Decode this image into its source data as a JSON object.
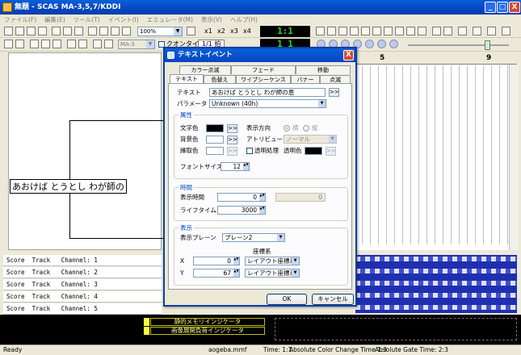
{
  "window": {
    "title": "無題 - SCAS MA-3,5,7/KDDI",
    "minimize": "_",
    "maximize": "□",
    "close": "X"
  },
  "menu": [
    "ファイル(F)",
    "編集(E)",
    "ツール(T)",
    "イベント(I)",
    "エミュレータ(M)",
    "表示(V)",
    "ヘルプ(H)"
  ],
  "toolbar": {
    "zoom": "100%",
    "scale_x1": "x1",
    "scale_x2": "x2",
    "scale_x3": "x3",
    "scale_x4": "x4",
    "lcd": "1:1",
    "model": "MA-3",
    "qwantize_label": "クオンタイズ",
    "beat": "1/1 拍"
  },
  "timeline": {
    "marker_5": "5",
    "marker_9": "9"
  },
  "editor": {
    "text": "あおけば とうとし わが師の"
  },
  "tracks": [
    {
      "label": "Score  Track   Channel: 1"
    },
    {
      "label": "Score  Track   Channel: 2"
    },
    {
      "label": "Score  Track   Channel: 3"
    },
    {
      "label": "Score  Track   Channel: 4"
    },
    {
      "label": "Score  Track   Channel: 5"
    }
  ],
  "indicators": {
    "memory": "静的メモリインジケータ",
    "image": "画像展開負荷インジケータ"
  },
  "status": {
    "ready": "Ready",
    "file": "aogeba.mmf",
    "time": "Time: 1:1",
    "color_change": "Absolute Color Change Time 1:3",
    "gate": "Absolute Gate Time: 2:3"
  },
  "dialog": {
    "title": "テキストイベント",
    "close": "X",
    "tabs_back": [
      "カラー点滅",
      "フェード",
      "移動"
    ],
    "tabs_front": [
      "テキスト",
      "色替え",
      "ワイプシーケンス",
      "バナー",
      "点滅"
    ],
    "text_label": "テキスト",
    "text_value": "あおけば とうとし わが師の恩",
    "browse": ">>",
    "param_label": "パラメータ",
    "param_value": "Unknown (40h)",
    "attr_group": "属性",
    "text_color": "文字色",
    "bg_color": "背景色",
    "edge_color": "縁取色",
    "direction": "表示方向",
    "horizontal": "横",
    "vertical": "縦",
    "attribute": "アトリビュート",
    "attribute_value": "ノーマル",
    "transparent": "透明処理",
    "trans_color": "透明色",
    "font_size_label": "フォントサイズ",
    "font_size": "12",
    "time_group": "時間",
    "display_time_label": "表示時間",
    "display_time": "0",
    "display_time_ro": "0",
    "lifetime_label": "ライフタイム",
    "lifetime": "3000",
    "display_group": "表示",
    "plane_label": "表示プレーン",
    "plane_value": "プレーン2",
    "coord_label": "座標系",
    "x_label": "X",
    "x_value": "0",
    "y_label": "Y",
    "y_value": "67",
    "coord_x": "レイアウト座標系",
    "coord_y": "レイアウト座標系",
    "ok": "OK",
    "cancel": "キャンセル"
  },
  "colors": {
    "title": "#0446c3",
    "lcd_green": "#2bd62b",
    "track_grid": "#1e2fb0"
  }
}
